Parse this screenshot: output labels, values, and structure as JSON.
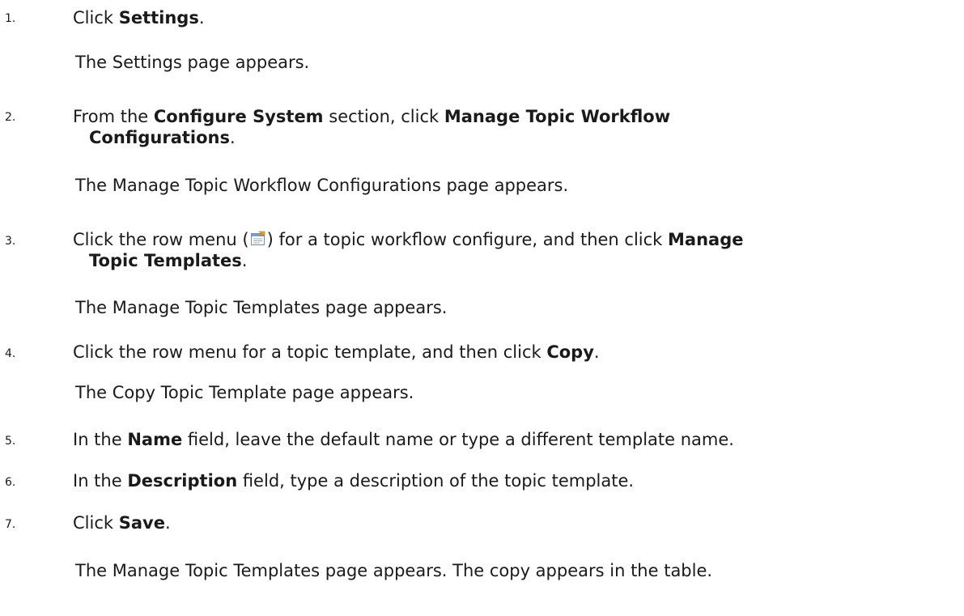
{
  "steps": [
    {
      "number": "1.",
      "text_before": "Click ",
      "bold": "Settings",
      "text_after": ".",
      "result": "The Settings page appears."
    },
    {
      "number": "2.",
      "text_before": "From the ",
      "bold1": "Configure System",
      "text_mid": " section, click ",
      "bold2_line1": "Manage Topic Workflow",
      "bold2_line2": "Configurations",
      "text_after": ".",
      "result": "The Manage Topic Workflow Configurations page appears."
    },
    {
      "number": "3.",
      "text_before": "Click the row menu (",
      "icon": "row-menu-icon",
      "text_mid": ") for a topic workflow configure, and then click ",
      "bold_line1": "Manage",
      "bold_line2": "Topic Templates",
      "text_after": ".",
      "result": "The Manage Topic Templates page appears."
    },
    {
      "number": "4.",
      "text_before": "Click the row menu for a topic template, and then click ",
      "bold": "Copy",
      "text_after": ".",
      "result": "The Copy Topic Template page appears."
    },
    {
      "number": "5.",
      "text_before": "In the ",
      "bold": "Name",
      "text_after": " field, leave the default name or type a different template name."
    },
    {
      "number": "6.",
      "text_before": "In the ",
      "bold": "Description",
      "text_after": " field, type a description of the topic template."
    },
    {
      "number": "7.",
      "text_before": "Click ",
      "bold": "Save",
      "text_after": ".",
      "result": "The Manage Topic Templates page appears. The copy appears in the table."
    }
  ]
}
